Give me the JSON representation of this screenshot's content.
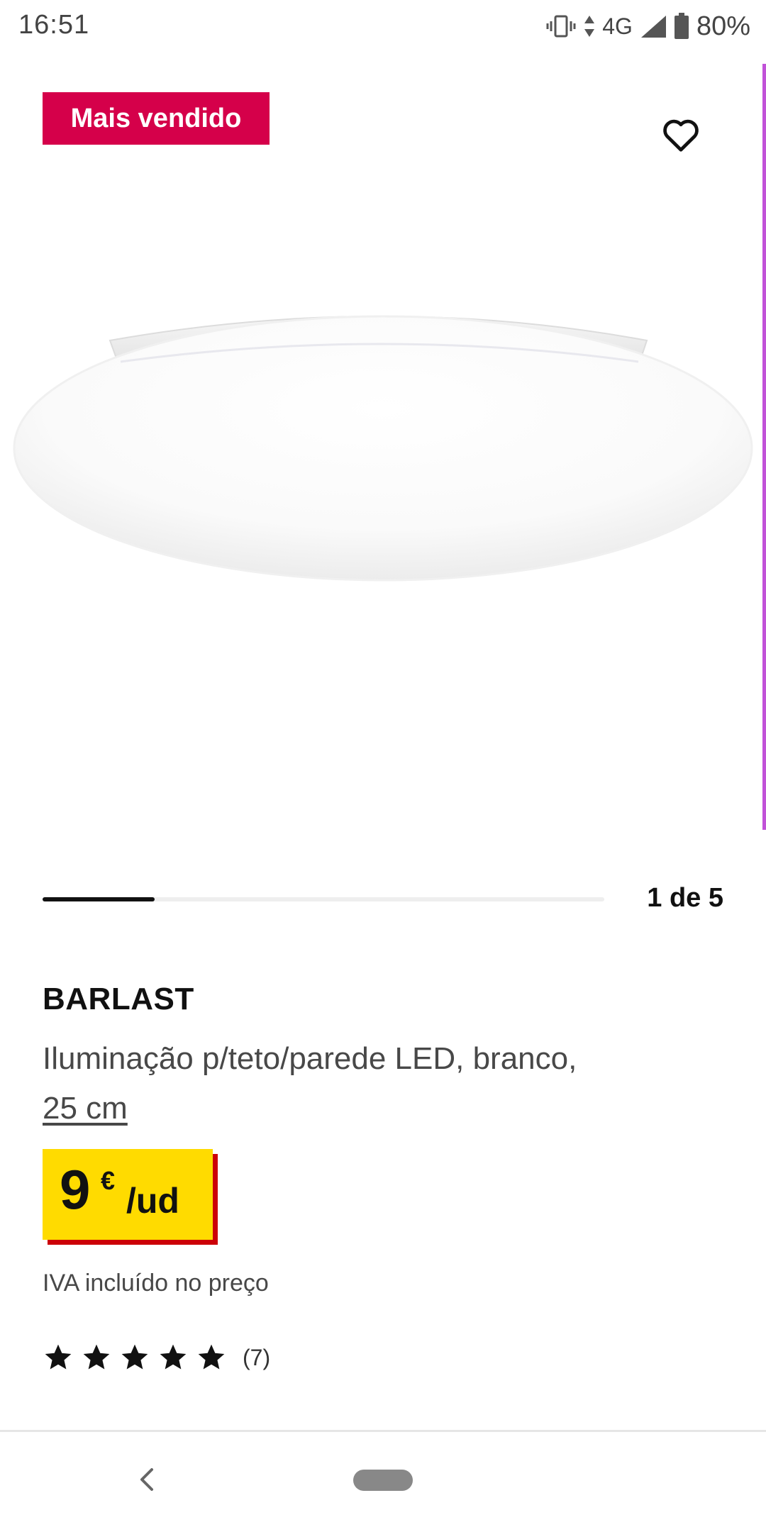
{
  "status_bar": {
    "time": "16:51",
    "network": "4G",
    "battery": "80%"
  },
  "product": {
    "badge": "Mais vendido",
    "name": "BARLAST",
    "description": "Iluminação p/teto/parede LED, branco,",
    "size": "25 cm",
    "price": {
      "amount": "9",
      "currency": "€",
      "unit": "/ud"
    },
    "vat_note": "IVA incluído no preço",
    "rating": {
      "stars": 5,
      "max": 5,
      "review_count": "(7)"
    }
  },
  "gallery": {
    "pager": "1 de 5",
    "current": 1,
    "total": 5
  },
  "colors": {
    "badge": "#d5004a",
    "price_bg": "#ffdb00",
    "price_shadow": "#cc0008"
  },
  "icons": {
    "favorite": "heart-outline-icon",
    "rating": "star-icon",
    "nav_back": "back-chevron-icon",
    "nav_home": "home-pill-icon"
  }
}
